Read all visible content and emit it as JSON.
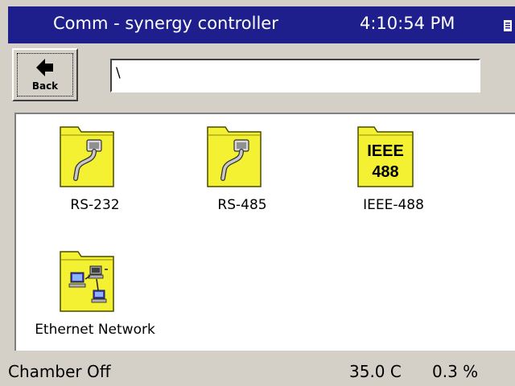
{
  "titlebar": {
    "title": "Comm - synergy controller",
    "clock": "4:10:54 PM",
    "status_icon": "document-icon"
  },
  "toolbar": {
    "back_label": "Back",
    "back_icon": "left-arrow-icon",
    "path_value": "\\"
  },
  "items": [
    {
      "label": "RS-232",
      "icon": "serial-cable-folder-icon"
    },
    {
      "label": "RS-485",
      "icon": "serial-cable-folder-icon"
    },
    {
      "label": "IEEE-488",
      "icon": "ieee-488-folder-icon",
      "icon_text_1": "IEEE",
      "icon_text_2": "488"
    },
    {
      "label": "Ethernet Network",
      "icon": "network-computers-folder-icon"
    }
  ],
  "status": {
    "left": "Chamber Off",
    "temperature": "35.0 C",
    "humidity": "0.3 %"
  },
  "colors": {
    "titlebar_bg": "#1e1e8c",
    "folder_yellow": "#f4f032",
    "chrome_gray": "#d4d0c8"
  }
}
